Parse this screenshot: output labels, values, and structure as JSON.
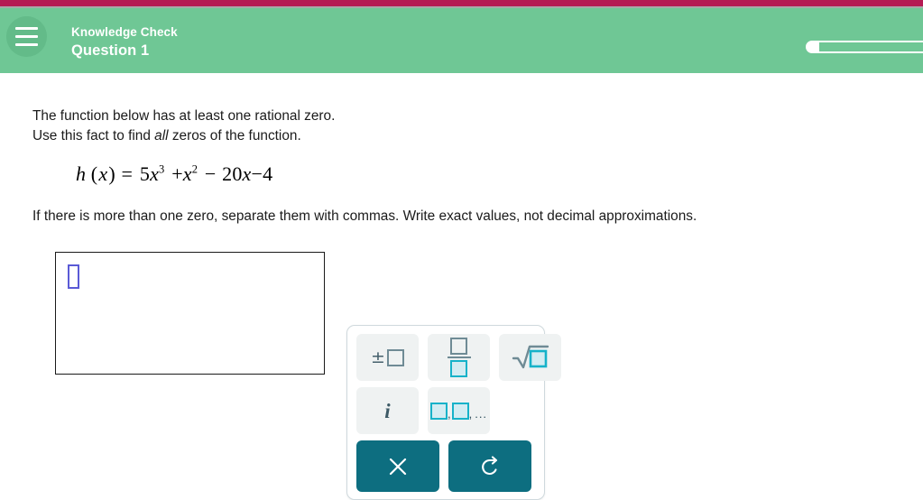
{
  "top_bar": {
    "accent_color": "#b51a53",
    "divider_color": "#a8a8a8"
  },
  "header": {
    "background_color": "#6fc795",
    "menu_icon": "hamburger-icon",
    "subtitle": "Knowledge Check",
    "title": "Question 1",
    "progress": {
      "value_percent": 9,
      "track_color": "#ffffff",
      "fill_color": "#ffffff"
    }
  },
  "question": {
    "prompt_line_1": "The function below has at least one rational zero.",
    "prompt_line_2_before": "Use this fact to find ",
    "prompt_line_2_emphasis": "all",
    "prompt_line_2_after": " zeros of the function.",
    "equation_plain": "h(x) = 5x^3 + x^2 - 20x - 4",
    "equation_parts": {
      "function_name": "h",
      "variable": "x",
      "term1_coeff": "5",
      "term1_exponent": "3",
      "term2_coeff": "",
      "term2_exponent": "2",
      "term3_coeff": "20",
      "constant": "4",
      "equals": "=",
      "plus": "+",
      "minus": "−"
    },
    "instruction": "If there is more than one zero, separate them with commas. Write exact values, not decimal approximations."
  },
  "answer_area": {
    "value": "",
    "placeholder_symbol": "empty-box",
    "border_color": "#1a1a1a",
    "placeholder_color": "#5a5ad6"
  },
  "math_palette": {
    "background_color": "#ffffff",
    "border_color": "#cfd9dd",
    "button_background": "#eff2f2",
    "action_button_color": "#0d6e80",
    "cyan_accent": "#16b2c9",
    "slate_accent": "#6f8b95",
    "buttons": [
      {
        "name": "plus-minus-button",
        "label": "±□",
        "type": "insert"
      },
      {
        "name": "fraction-button",
        "label": "□/□",
        "type": "insert"
      },
      {
        "name": "square-root-button",
        "label": "√□",
        "type": "insert"
      },
      {
        "name": "imaginary-unit-button",
        "label": "i",
        "type": "insert"
      },
      {
        "name": "list-button",
        "label": "□,□,...",
        "type": "insert"
      },
      {
        "name": "clear-button",
        "label": "×",
        "type": "action"
      },
      {
        "name": "undo-button",
        "label": "↺",
        "type": "action"
      }
    ]
  }
}
